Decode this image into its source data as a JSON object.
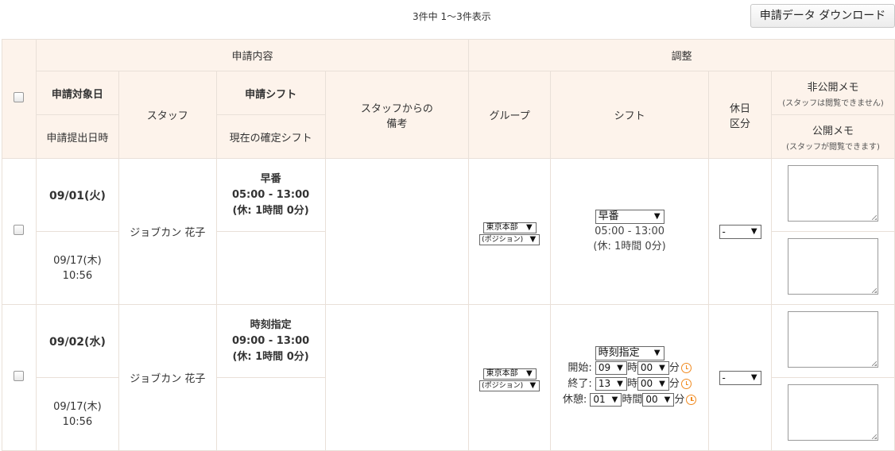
{
  "header": {
    "count_text": "3件中 1〜3件表示",
    "download_button": "申請データ ダウンロード"
  },
  "table": {
    "group_request": "申請内容",
    "group_adjust": "調整",
    "col_target_date": "申請対象日",
    "col_submitted": "申請提出日時",
    "col_staff": "スタッフ",
    "col_req_shift": "申請シフト",
    "col_current_shift": "現在の確定シフト",
    "col_staff_note_1": "スタッフからの",
    "col_staff_note_2": "備考",
    "col_group": "グループ",
    "col_shift": "シフト",
    "col_holiday_1": "休日",
    "col_holiday_2": "区分",
    "col_private_memo": "非公開メモ",
    "col_private_memo_sub": "(スタッフは閲覧できません)",
    "col_public_memo": "公開メモ",
    "col_public_memo_sub": "(スタッフが閲覧できます)"
  },
  "rows": [
    {
      "target_date": "09/01(火)",
      "submitted_date": "09/17(木)",
      "submitted_time": "10:56",
      "staff": "ジョブカン 花子",
      "req_shift_name": "早番",
      "req_shift_time": "05:00 - 13:00",
      "req_shift_break": "(休: 1時間 0分)",
      "group_select": "東京本部",
      "position_select": "(ポジション)",
      "shift_select": "早番",
      "shift_time": "05:00 - 13:00",
      "shift_break": "(休: 1時間 0分)",
      "holiday_select": "-"
    },
    {
      "target_date": "09/02(水)",
      "submitted_date": "09/17(木)",
      "submitted_time": "10:56",
      "staff": "ジョブカン 花子",
      "req_shift_name": "時刻指定",
      "req_shift_time": "09:00 - 13:00",
      "req_shift_break": "(休: 1時間 0分)",
      "group_select": "東京本部",
      "position_select": "(ポジション)",
      "shift_select": "時刻指定",
      "start_label": "開始:",
      "start_hour": "09",
      "start_min": "00",
      "end_label": "終了:",
      "end_hour": "13",
      "end_min": "00",
      "break_label": "休憩:",
      "break_hour": "01",
      "break_min": "00",
      "hour_unit": "時",
      "hours_unit": "時間",
      "min_unit": "分",
      "holiday_select": "-"
    }
  ],
  "icons": {
    "checkbox": "checkbox-icon",
    "clock": "clock-icon"
  },
  "colors": {
    "header_bg": "#fdf3eb",
    "border": "#e9e0d8",
    "clock": "#f08a20"
  }
}
